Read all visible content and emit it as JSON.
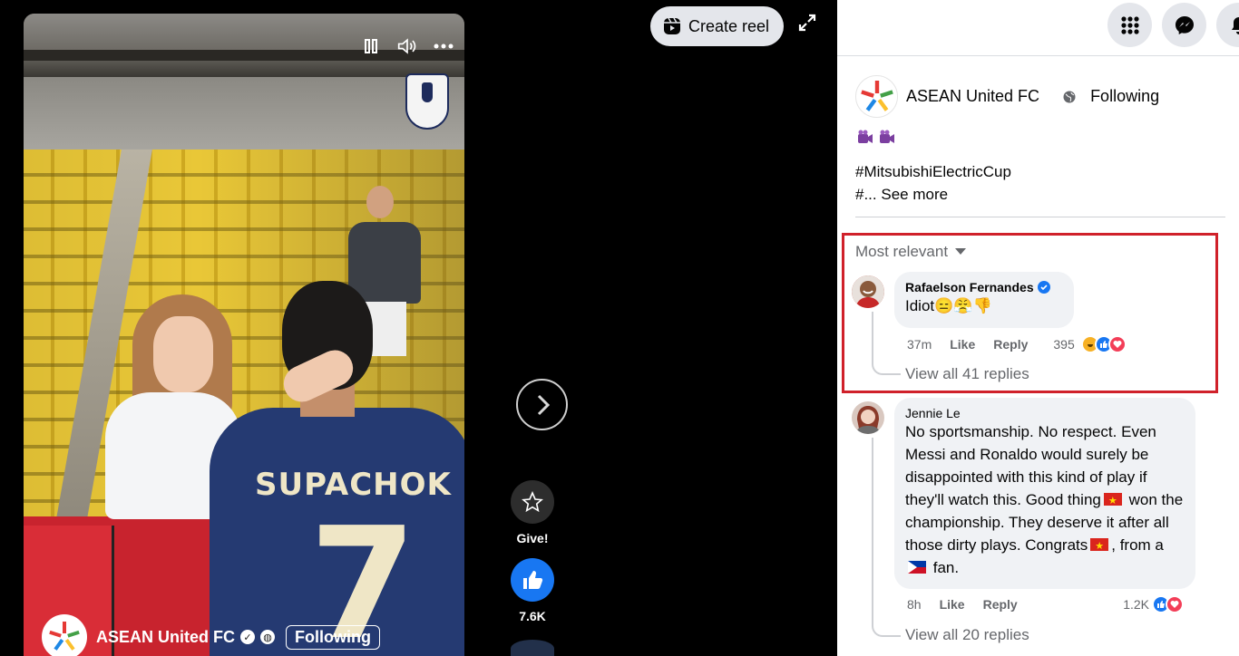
{
  "viewer": {
    "create_reel_label": "Create reel",
    "video": {
      "jersey_name": "SUPACHOK",
      "jersey_number": "7",
      "footer_page_name": "ASEAN United FC",
      "footer_follow_label": "Following"
    },
    "actions": {
      "give_label": "Give!",
      "like_count": "7.6K"
    }
  },
  "post": {
    "page_name": "ASEAN United FC",
    "follow_label": "Following",
    "caption_line1": "#MitsubishiElectricCup",
    "caption_line2": "#... ",
    "see_more_label": "See more",
    "sort_label": "Most relevant"
  },
  "comments": [
    {
      "author": "Rafaelson Fernandes",
      "verified": true,
      "text": "Idiot",
      "time": "37m",
      "like_label": "Like",
      "reply_label": "Reply",
      "reaction_count": "395",
      "view_replies": "View all 41 replies"
    },
    {
      "author": "Jennie Le",
      "text_part1": "No sportsmanship. No respect. Even Messi and Ronaldo would surely be disappointed with this kind of play if they'll watch this. Good thing",
      "text_part2": "won the championship. They deserve it after all those dirty plays. Congrats",
      "text_part3": ", from a",
      "text_part4": "fan.",
      "time": "8h",
      "like_label": "Like",
      "reply_label": "Reply",
      "reaction_count": "1.2K",
      "view_replies": "View all 20 replies"
    }
  ],
  "colors": {
    "accent_blue": "#1877f2",
    "highlight_red": "#d0212a",
    "bubble_bg": "#f0f2f5"
  }
}
